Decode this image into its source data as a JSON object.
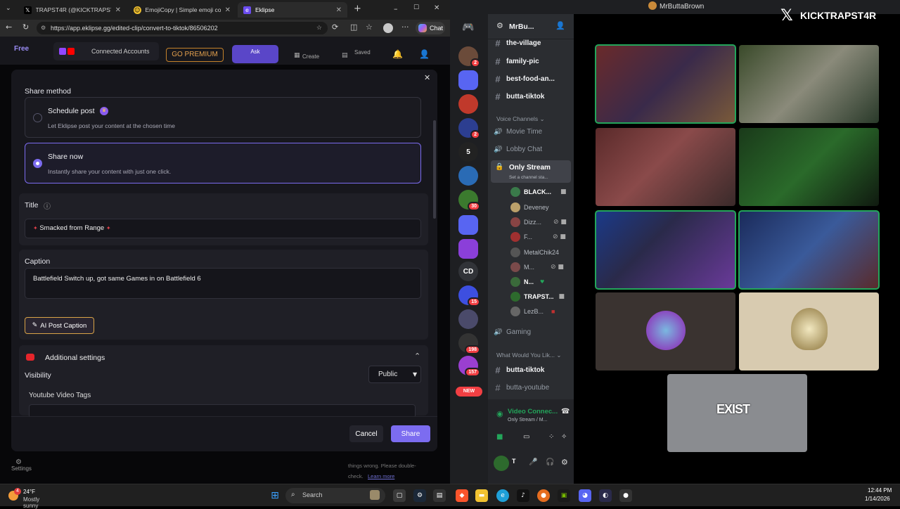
{
  "browser": {
    "tabs": [
      {
        "label": "TRAPST4R (@KICKTRAPST4R) / X",
        "icon": "x-logo-icon"
      },
      {
        "label": "EmojiCopy | Simple emoji copy a...",
        "icon": "emoji-icon"
      },
      {
        "label": "Eklipse",
        "icon": "eklipse-icon"
      }
    ],
    "url": "https://app.eklipse.gg/edited-clip/convert-to-tiktok/86506202",
    "chat_label": "Chat"
  },
  "eklipse": {
    "plan_badge": "Free",
    "connected_accounts": "Connected Accounts",
    "go_premium": "GO PREMIUM",
    "ask": "Ask",
    "create": "Create",
    "saved": "Saved",
    "settings_label": "Settings",
    "bottom_note_1": "things wrong. Please double-",
    "bottom_note_2": "check.",
    "learn_more": "Learn more"
  },
  "modal": {
    "share_method_label": "Share method",
    "options": [
      {
        "title": "Schedule post",
        "desc": "Let Eklipse post your content at the chosen time",
        "selected": false
      },
      {
        "title": "Share now",
        "desc": "Instantly share your content with just one click.",
        "selected": true
      }
    ],
    "title_label": "Title",
    "title_value": "Smacked from Range",
    "caption_label": "Caption",
    "caption_value": "Battlefield Switch up, got same Games in on Battlefield 6",
    "ai_caption_button": "AI Post Caption",
    "additional_settings": "Additional settings",
    "visibility_label": "Visibility",
    "visibility_value": "Public",
    "youtube_tags_label": "Youtube Video Tags",
    "cancel": "Cancel",
    "share": "Share",
    "accent_color": "#7c6cf0"
  },
  "discord": {
    "window_title": "MrButtaBrown",
    "server_name": "MrBu...",
    "guild_badges": [
      "2",
      "2",
      "5",
      "30",
      "15",
      "198",
      "157",
      "NEW"
    ],
    "guild_text": "CD",
    "text_channels": [
      "the-village",
      "family-pic",
      "best-food-an...",
      "butta-tiktok"
    ],
    "voice_category": "Voice Channels",
    "voice_channels": [
      "Movie Time",
      "Lobby Chat"
    ],
    "active_voice": "Only Stream",
    "active_voice_status": "Set a channel sta...",
    "voice_users": [
      "BLACK...",
      "Deveney",
      "Dizz...",
      "F...",
      "MetalChik24",
      "M...",
      "N...",
      "TRAPST...",
      "LezB..."
    ],
    "gaming_channel": "Gaming",
    "category_2": "What Would You Lik...",
    "more_channels": [
      "butta-tiktok",
      "butta-youtube"
    ],
    "video_connected": "Video Connec...",
    "video_connected_sub": "Only Stream / M...",
    "user_initial": "T",
    "watermark": "KICKTRAPST4R",
    "tile_text": "EXIST"
  },
  "taskbar": {
    "weather_temp": "24°F",
    "weather_desc": "Mostly sunny",
    "weather_badge": "4",
    "search_placeholder": "Search",
    "time": "12:44 PM",
    "date": "1/14/2026"
  }
}
